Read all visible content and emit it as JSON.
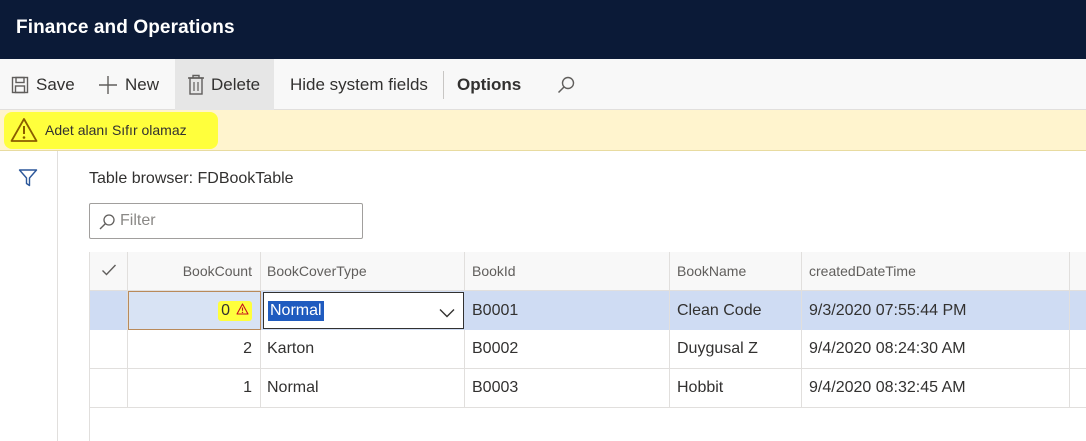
{
  "app": {
    "title": "Finance and Operations"
  },
  "toolbar": {
    "save_label": "Save",
    "new_label": "New",
    "delete_label": "Delete",
    "hide_label": "Hide system fields",
    "options_label": "Options"
  },
  "message": {
    "text": "Adet alanı Sıfır olamaz"
  },
  "page": {
    "title": "Table browser: FDBookTable"
  },
  "filter": {
    "placeholder": "Filter"
  },
  "grid": {
    "columns": [
      "BookCount",
      "BookCoverType",
      "BookId",
      "BookName",
      "createdDateTime"
    ],
    "rows": [
      {
        "count": "0",
        "cover": "Normal",
        "id": "B0001",
        "name": "Clean Code",
        "created": "9/3/2020 07:55:44 PM"
      },
      {
        "count": "2",
        "cover": "Karton",
        "id": "B0002",
        "name": "Duygusal Z",
        "created": "9/4/2020 08:24:30 AM"
      },
      {
        "count": "1",
        "cover": "Normal",
        "id": "B0003",
        "name": "Hobbit",
        "created": "9/4/2020 08:32:45 AM"
      }
    ]
  },
  "colors": {
    "appbar": "#0b1a37",
    "message_bg": "#fff4ce",
    "highlight": "#ffff3c",
    "selected_row": "#cfdcf3",
    "selection": "#1f5bbf"
  },
  "icons": [
    "save-icon",
    "plus-icon",
    "trash-icon",
    "search-icon",
    "warning-icon",
    "filter-funnel-icon",
    "checkmark-icon",
    "chevron-down-icon"
  ]
}
